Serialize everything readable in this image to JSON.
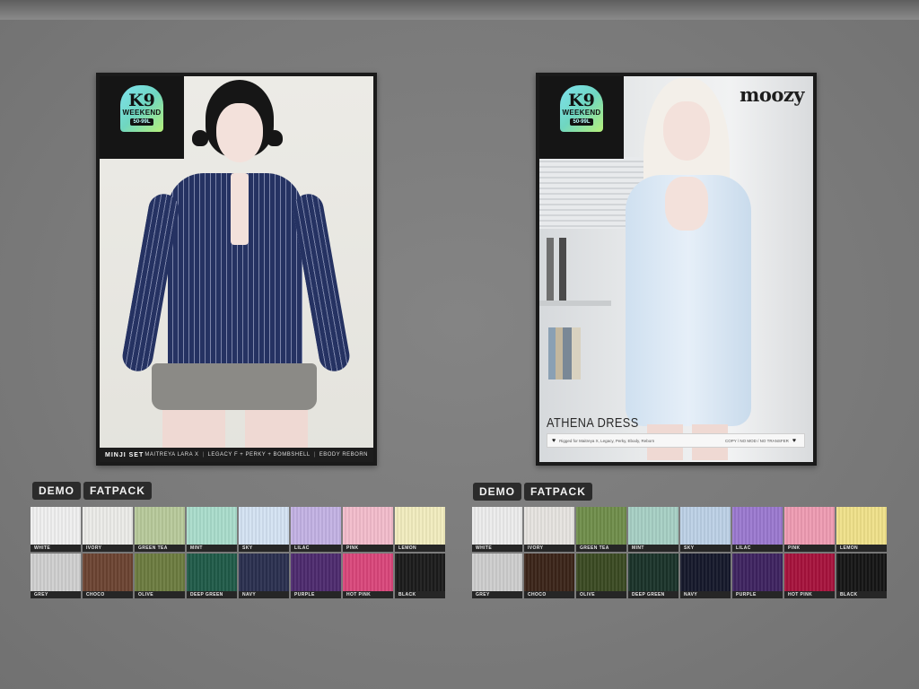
{
  "colors": {
    "background": "#7a7a7a",
    "tag_bg": "#2b2b2b",
    "frame": "#1a1a1a"
  },
  "badge": {
    "logo_text": "K9",
    "logo_subtext": "WEEKEND",
    "logo_price": "50-99L"
  },
  "posters": {
    "left": {
      "title": "MINJI SET",
      "bodies": [
        "MAITREYA LARA X",
        "LEGACY F + PERKY + BOMBSHELL",
        "EBODY REBORN"
      ]
    },
    "right": {
      "brand": "moozy",
      "title": "ATHENA DRESS",
      "info_left": "Rigged for Maitreya X, Legacy, Perky, Ebody, Reborn",
      "info_right": "COPY / NO MOD / NO TRANSFER"
    }
  },
  "tags": {
    "left": [
      "DEMO",
      "FATPACK"
    ],
    "right": [
      "DEMO",
      "FATPACK"
    ]
  },
  "swatches": {
    "left": [
      {
        "name": "WHITE",
        "color": "#efefef"
      },
      {
        "name": "IVORY",
        "color": "#ebebe8"
      },
      {
        "name": "GREEN TEA",
        "color": "#b7c99a"
      },
      {
        "name": "MINT",
        "color": "#a9dccb"
      },
      {
        "name": "SKY",
        "color": "#d3e2f2"
      },
      {
        "name": "LILAC",
        "color": "#c2b1e3"
      },
      {
        "name": "PINK",
        "color": "#f2bccb"
      },
      {
        "name": "LEMON",
        "color": "#f1ecbe"
      },
      {
        "name": "GREY",
        "color": "#cfcfcf"
      },
      {
        "name": "CHOCO",
        "color": "#6b4331"
      },
      {
        "name": "OLIVE",
        "color": "#6b7b3f"
      },
      {
        "name": "DEEP GREEN",
        "color": "#1f5a48"
      },
      {
        "name": "NAVY",
        "color": "#2a2f4f"
      },
      {
        "name": "PURPLE",
        "color": "#4d2a6e"
      },
      {
        "name": "HOT PINK",
        "color": "#d9467a"
      },
      {
        "name": "BLACK",
        "color": "#1b1b1b"
      }
    ],
    "right": [
      {
        "name": "WHITE",
        "color": "#ececec"
      },
      {
        "name": "IVORY",
        "color": "#e6e3df"
      },
      {
        "name": "GREEN TEA",
        "color": "#6f8d4a"
      },
      {
        "name": "MINT",
        "color": "#a6cfc4"
      },
      {
        "name": "SKY",
        "color": "#bcd0e6"
      },
      {
        "name": "LILAC",
        "color": "#9a78cf"
      },
      {
        "name": "PINK",
        "color": "#ee9bb2"
      },
      {
        "name": "LEMON",
        "color": "#efe089"
      },
      {
        "name": "GREY",
        "color": "#cdcdcd"
      },
      {
        "name": "CHOCO",
        "color": "#3b2418"
      },
      {
        "name": "OLIVE",
        "color": "#3a4a22"
      },
      {
        "name": "DEEP GREEN",
        "color": "#1a3329"
      },
      {
        "name": "NAVY",
        "color": "#15182b"
      },
      {
        "name": "PURPLE",
        "color": "#3e2360"
      },
      {
        "name": "HOT PINK",
        "color": "#a6123c"
      },
      {
        "name": "BLACK",
        "color": "#151515"
      }
    ]
  }
}
